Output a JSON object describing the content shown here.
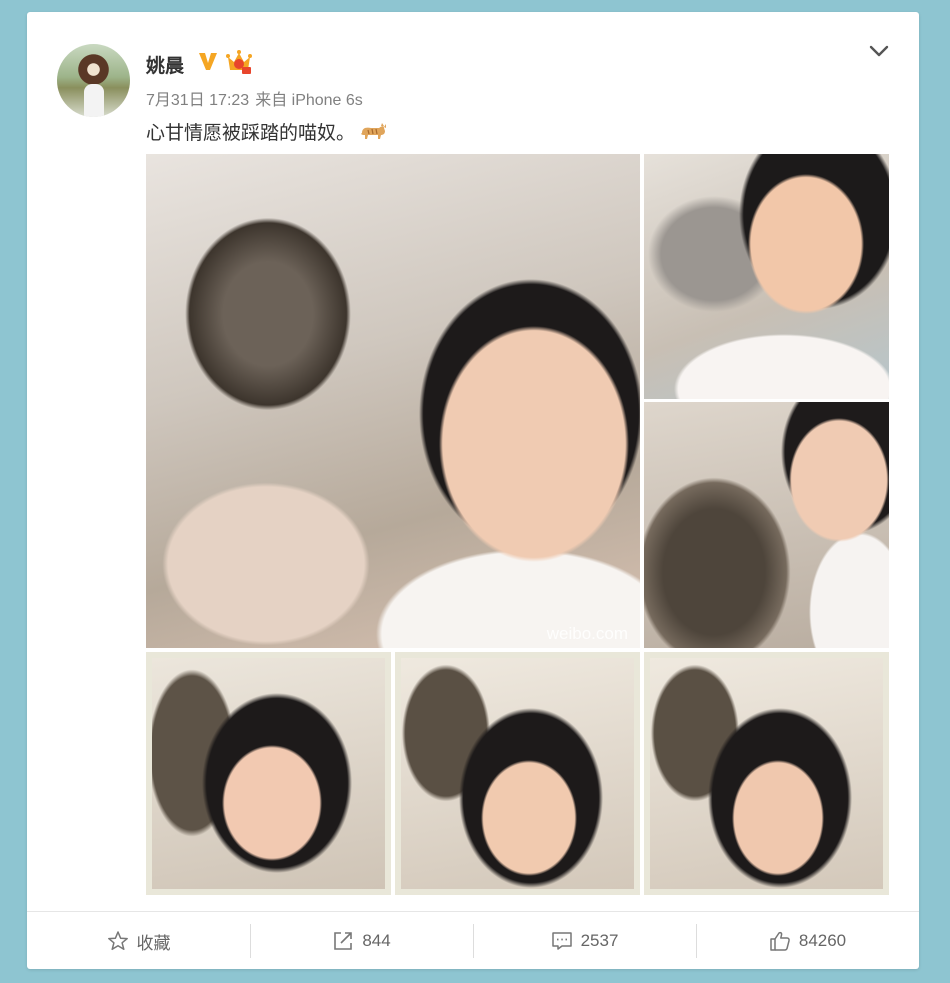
{
  "post": {
    "username": "姚晨",
    "time": "7月31日 17:23",
    "source": "来自 iPhone 6s",
    "text": "心甘情愿被踩踏的喵奴。",
    "watermark": "weibo.com",
    "badges": {
      "verified_icon": "verified-v-icon",
      "vip_icon": "vip-crown-icon",
      "verified_color": "#f5a623"
    }
  },
  "images": [
    {
      "name": "photo-main",
      "description_icon": "photo"
    },
    {
      "name": "photo-top-right-1"
    },
    {
      "name": "photo-top-right-2"
    },
    {
      "name": "photo-bottom-1"
    },
    {
      "name": "photo-bottom-2"
    },
    {
      "name": "photo-bottom-3"
    }
  ],
  "actions": {
    "favorite": {
      "label": "收藏",
      "icon": "star-icon"
    },
    "repost": {
      "label": "844",
      "icon": "repost-icon"
    },
    "comment": {
      "label": "2537",
      "icon": "comment-icon"
    },
    "like": {
      "label": "84260",
      "icon": "thumbs-up-icon"
    }
  },
  "colors": {
    "background": "#8ec5d1",
    "card": "#ffffff",
    "text": "#333333",
    "meta": "#808080"
  }
}
